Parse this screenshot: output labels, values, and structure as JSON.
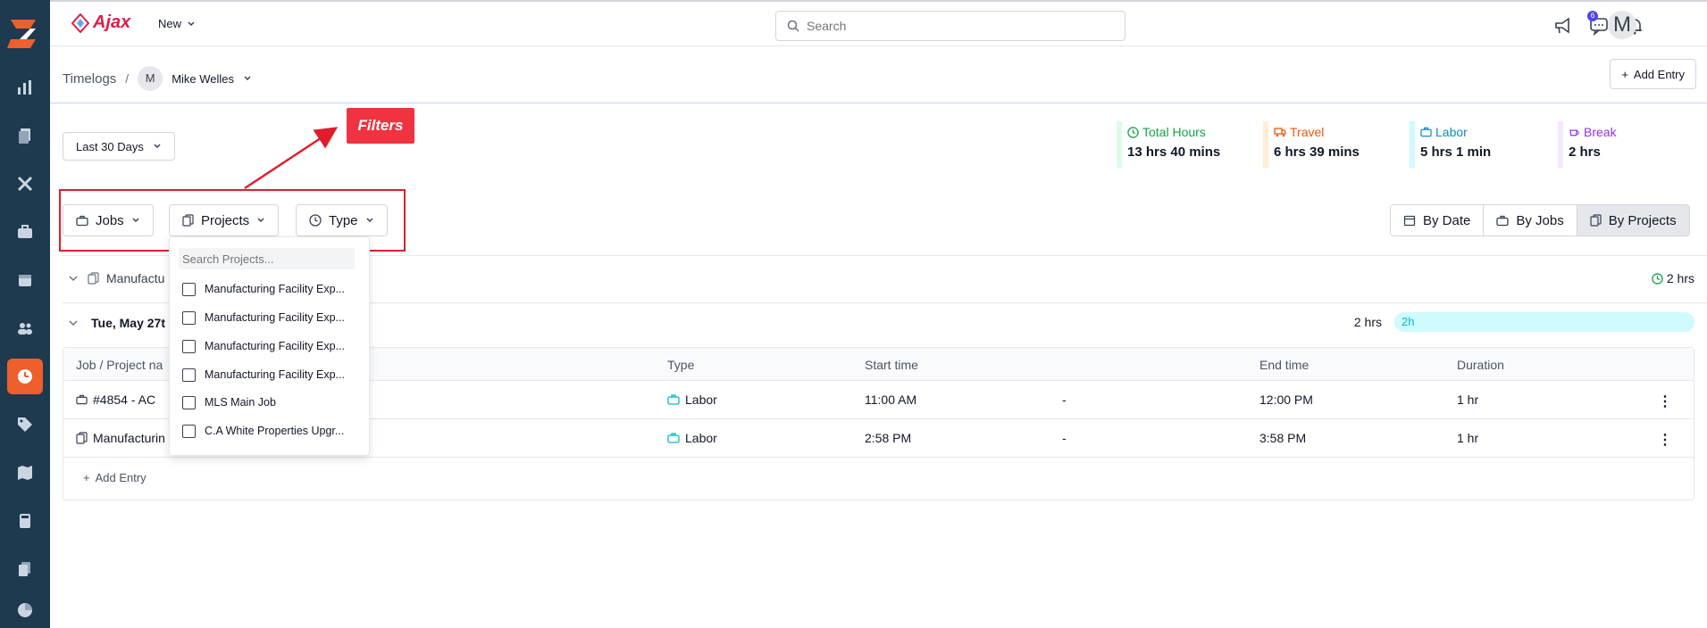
{
  "brand": {
    "name": "Ajax"
  },
  "topbar": {
    "new_label": "New",
    "search_placeholder": "Search",
    "notification_count": "6",
    "user_initial": "M"
  },
  "breadcrumb": {
    "root": "Timelogs",
    "separator": "/",
    "user_initial": "M",
    "user_name": "Mike Welles"
  },
  "actions": {
    "add_entry": "Add Entry"
  },
  "filters": {
    "range": "Last 30 Days",
    "annotation": "Filters",
    "jobs": "Jobs",
    "projects": "Projects",
    "type": "Type"
  },
  "stats": [
    {
      "label": "Total Hours",
      "value": "13 hrs 40 mins",
      "color": "#16a34a",
      "bar": "#dcfce7"
    },
    {
      "label": "Travel",
      "value": "6 hrs 39 mins",
      "color": "#ea580c",
      "bar": "#ffedd5"
    },
    {
      "label": "Labor",
      "value": "5 hrs 1 min",
      "color": "#0891b2",
      "bar": "#cffafe"
    },
    {
      "label": "Break",
      "value": "2 hrs",
      "color": "#9333ea",
      "bar": "#f3e8ff"
    }
  ],
  "views": {
    "by_date": "By Date",
    "by_jobs": "By Jobs",
    "by_projects": "By Projects"
  },
  "group": {
    "project": "Manufactu",
    "total": "2 hrs"
  },
  "day": {
    "label": "Tue, May 27t",
    "hours": "2 hrs",
    "pill": "2h"
  },
  "table": {
    "headers": {
      "job": "Job / Project na",
      "type": "Type",
      "start": "Start time",
      "end": "End time",
      "duration": "Duration"
    },
    "rows": [
      {
        "job": "#4854 - AC",
        "type": "Labor",
        "start": "11:00 AM",
        "dash": "-",
        "end": "12:00 PM",
        "duration": "1 hr"
      },
      {
        "job": "Manufacturin",
        "type": "Labor",
        "start": "2:58 PM",
        "dash": "-",
        "end": "3:58 PM",
        "duration": "1 hr"
      }
    ],
    "add_entry": "Add Entry"
  },
  "dropdown": {
    "search_placeholder": "Search Projects...",
    "items": [
      "Manufacturing Facility Exp...",
      "Manufacturing Facility Exp...",
      "Manufacturing Facility Exp...",
      "Manufacturing Facility Exp...",
      "MLS Main Job",
      "C.A White Properties Upgr..."
    ]
  },
  "colors": {
    "sidebar": "#1e3a4f",
    "accent": "#ef5f2e",
    "annotation": "#ef3340"
  }
}
